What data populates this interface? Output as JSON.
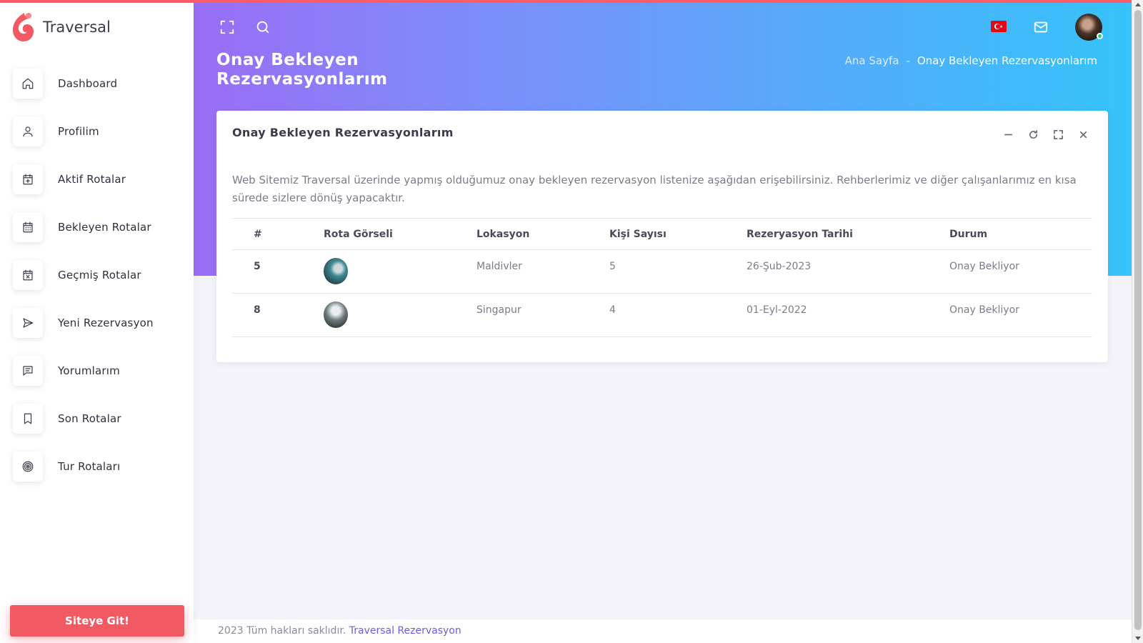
{
  "brand": {
    "name": "Traversal",
    "logo_icon": "flame-logo-icon",
    "logo_color": "#f25a63"
  },
  "sidebar": {
    "items": [
      {
        "label": "Dashboard",
        "icon": "home-icon"
      },
      {
        "label": "Profilim",
        "icon": "user-icon"
      },
      {
        "label": "Aktif Rotalar",
        "icon": "calendar-plus-icon"
      },
      {
        "label": "Bekleyen Rotalar",
        "icon": "calendar-icon"
      },
      {
        "label": "Geçmiş Rotalar",
        "icon": "calendar-x-icon"
      },
      {
        "label": "Yeni Rezervasyon",
        "icon": "send-icon"
      },
      {
        "label": "Yorumlarım",
        "icon": "message-icon"
      },
      {
        "label": "Son Rotalar",
        "icon": "bookmark-icon"
      },
      {
        "label": "Tur Rotaları",
        "icon": "target-icon"
      }
    ],
    "cta_label": "Siteye Git!"
  },
  "topbar": {
    "icons": [
      "fullscreen-icon",
      "search-icon",
      "turkey-flag-icon",
      "mail-icon",
      "user-avatar"
    ],
    "language_flag": "TR"
  },
  "page": {
    "title": "Onay Bekleyen Rezervasyonlarım"
  },
  "breadcrumb": {
    "home": "Ana Sayfa",
    "separator": "-",
    "current": "Onay Bekleyen Rezervasyonlarım"
  },
  "card": {
    "title": "Onay Bekleyen Rezervasyonlarım",
    "tools": [
      "minimize-icon",
      "refresh-icon",
      "expand-icon",
      "close-icon"
    ],
    "description": "Web Sitemiz Traversal üzerinde yapmış olduğumuz onay bekleyen rezervasyon listenize aşağıdan erişebilirsiniz. Rehberlerimiz ve diğer çalışanlarımız en kısa sürede sizlere dönüş yapacaktır."
  },
  "table": {
    "headers": [
      "#",
      "Rota Görseli",
      "Lokasyon",
      "Kişi Sayısı",
      "Rezeryasyon Tarihi",
      "Durum"
    ],
    "rows": [
      {
        "id": "5",
        "image": "maldives-thumbnail",
        "location": "Maldivler",
        "people": "5",
        "date": "26-Şub-2023",
        "status": "Onay Bekliyor"
      },
      {
        "id": "8",
        "image": "singapore-thumbnail",
        "location": "Singapur",
        "people": "4",
        "date": "01-Eyl-2022",
        "status": "Onay Bekliyor"
      }
    ]
  },
  "footer": {
    "text": "2023 Tüm hakları saklıdır.",
    "link": "Traversal Rezervasyon"
  },
  "colors": {
    "accent": "#f25a63",
    "gradient_start": "#9a6df5",
    "gradient_end": "#35c3f8",
    "link": "#6b5de0"
  }
}
